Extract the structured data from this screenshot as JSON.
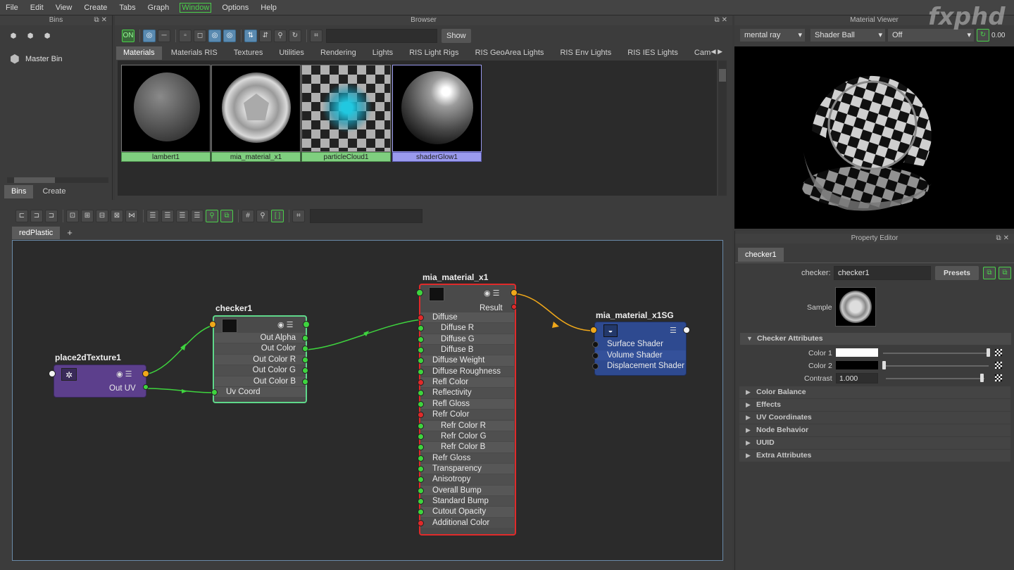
{
  "menubar": [
    "File",
    "Edit",
    "View",
    "Create",
    "Tabs",
    "Graph",
    "Window",
    "Options",
    "Help"
  ],
  "watermark": "fxphd",
  "bins": {
    "title": "Bins",
    "master_bin": "Master Bin",
    "tabs": [
      "Bins",
      "Create"
    ]
  },
  "browser": {
    "title": "Browser",
    "toolbar_on": "ON",
    "show_button": "Show",
    "tabs": [
      "Materials",
      "Materials RIS",
      "Textures",
      "Utilities",
      "Rendering",
      "Lights",
      "RIS Light Rigs",
      "RIS GeoArea Lights",
      "RIS Env Lights",
      "RIS IES Lights",
      "Cameras"
    ],
    "swatches": [
      {
        "label": "lambert1"
      },
      {
        "label": "mia_material_x1"
      },
      {
        "label": "particleCloud1"
      },
      {
        "label": "shaderGlow1"
      }
    ]
  },
  "material_viewer": {
    "title": "Material Viewer",
    "renderer": "mental ray",
    "geometry": "Shader Ball",
    "env": "Off",
    "value": "0.00"
  },
  "node_editor": {
    "tab": "redPlastic",
    "add_tab": "+",
    "nodes": {
      "place2d": {
        "title": "place2dTexture1",
        "out": "Out UV"
      },
      "checker": {
        "title": "checker1",
        "rows": [
          "Out Alpha",
          "Out Color",
          "Out Color R",
          "Out Color G",
          "Out Color B",
          "Uv Coord"
        ]
      },
      "mia": {
        "title": "mia_material_x1",
        "result": "Result",
        "rows": [
          "Diffuse",
          "Diffuse R",
          "Diffuse G",
          "Diffuse B",
          "Diffuse Weight",
          "Diffuse Roughness",
          "Refl Color",
          "Reflectivity",
          "Refl Gloss",
          "Refr Color",
          "Refr Color R",
          "Refr Color G",
          "Refr Color B",
          "Refr Gloss",
          "Transparency",
          "Anisotropy",
          "Overall Bump",
          "Standard Bump",
          "Cutout Opacity",
          "Additional Color"
        ]
      },
      "sg": {
        "title": "mia_material_x1SG",
        "rows": [
          "Surface Shader",
          "Volume Shader",
          "Displacement Shader"
        ]
      }
    }
  },
  "property_editor": {
    "title": "Property Editor",
    "tab": "checker1",
    "node_label": "checker:",
    "node_value": "checker1",
    "presets": "Presets",
    "sample_label": "Sample",
    "section_open": "Checker Attributes",
    "color1_label": "Color 1",
    "color2_label": "Color 2",
    "contrast_label": "Contrast",
    "contrast_value": "1.000",
    "sections": [
      "Color Balance",
      "Effects",
      "UV Coordinates",
      "Node Behavior",
      "UUID",
      "Extra Attributes"
    ]
  }
}
